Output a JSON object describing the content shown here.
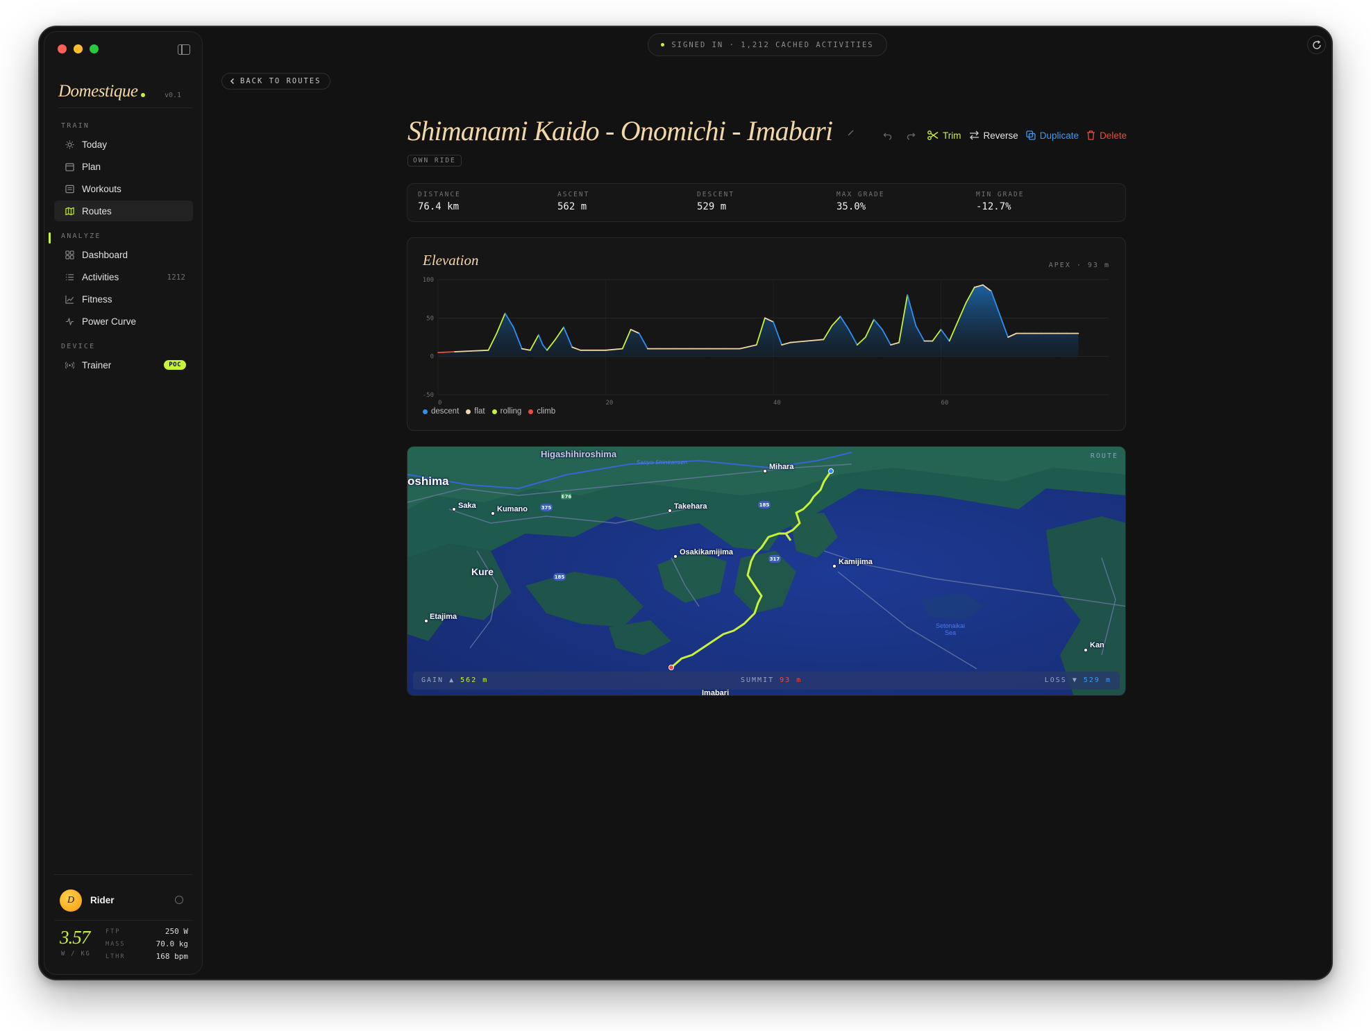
{
  "app": {
    "name": "Domestique",
    "version": "v0.1"
  },
  "status": {
    "text": "SIGNED IN · 1,212 CACHED ACTIVITIES"
  },
  "sidebar": {
    "sections": [
      {
        "label": "TRAIN"
      },
      {
        "label": "ANALYZE"
      },
      {
        "label": "DEVICE"
      }
    ],
    "items": [
      {
        "label": "Today",
        "icon": "sun-icon"
      },
      {
        "label": "Plan",
        "icon": "calendar-icon"
      },
      {
        "label": "Workouts",
        "icon": "list-icon"
      },
      {
        "label": "Routes",
        "icon": "map-icon",
        "active": true
      },
      {
        "label": "Dashboard",
        "icon": "grid-icon"
      },
      {
        "label": "Activities",
        "icon": "lines-icon",
        "count": "1212"
      },
      {
        "label": "Fitness",
        "icon": "trend-icon"
      },
      {
        "label": "Power Curve",
        "icon": "pulse-icon"
      },
      {
        "label": "Trainer",
        "icon": "broadcast-icon",
        "badge": "POC"
      }
    ],
    "user": {
      "initial": "D",
      "name": "Rider",
      "wkg": "3.57",
      "wkg_unit": "W / KG",
      "stats": [
        {
          "key": "FTP",
          "value": "250 W"
        },
        {
          "key": "MASS",
          "value": "70.0 kg"
        },
        {
          "key": "LTHR",
          "value": "168 bpm"
        }
      ]
    }
  },
  "header": {
    "back_label": "BACK TO ROUTES"
  },
  "route": {
    "title": "Shimanami Kaido - Onomichi - Imabari",
    "tag": "OWN RIDE",
    "actions": {
      "trim": "Trim",
      "reverse": "Reverse",
      "duplicate": "Duplicate",
      "delete": "Delete"
    },
    "stats": [
      {
        "key": "DISTANCE",
        "value": "76.4 km"
      },
      {
        "key": "ASCENT",
        "value": "562 m"
      },
      {
        "key": "DESCENT",
        "value": "529 m"
      },
      {
        "key": "MAX GRADE",
        "value": "35.0%"
      },
      {
        "key": "MIN GRADE",
        "value": "-12.7%"
      }
    ]
  },
  "elevation": {
    "title": "Elevation",
    "apex": "APEX · 93 m",
    "legend": [
      {
        "label": "descent",
        "color": "#2f8ff0"
      },
      {
        "label": "flat",
        "color": "#f2d7a8"
      },
      {
        "label": "rolling",
        "color": "#c8f23a"
      },
      {
        "label": "climb",
        "color": "#f04a3a"
      }
    ]
  },
  "chart_data": {
    "type": "area",
    "title": "Elevation",
    "xlabel": "",
    "ylabel": "",
    "xlim": [
      0,
      80
    ],
    "ylim": [
      -50,
      100
    ],
    "xticks": [
      "0",
      "20",
      "40",
      "60"
    ],
    "yticks": [
      "100",
      "50",
      "0",
      "-50"
    ],
    "x": [
      0,
      2,
      4,
      6,
      7,
      8,
      9,
      10,
      11,
      12,
      12.5,
      13,
      14,
      15,
      16,
      17,
      18,
      20,
      22,
      23,
      24,
      25,
      26,
      28,
      30,
      32,
      34,
      36,
      38,
      39,
      40,
      41,
      42,
      44,
      46,
      47,
      48,
      49,
      50,
      51,
      52,
      53,
      54,
      55,
      56,
      57,
      58,
      59,
      60,
      61,
      62,
      63,
      64,
      65,
      66,
      67,
      68,
      69,
      70,
      71,
      72,
      73,
      74,
      75,
      76,
      76.4
    ],
    "values": [
      5,
      6,
      7,
      8,
      30,
      56,
      38,
      10,
      8,
      28,
      15,
      8,
      22,
      38,
      12,
      8,
      8,
      8,
      10,
      35,
      30,
      10,
      10,
      10,
      10,
      10,
      10,
      10,
      15,
      50,
      45,
      15,
      18,
      20,
      22,
      40,
      52,
      35,
      15,
      25,
      48,
      35,
      15,
      18,
      80,
      40,
      20,
      20,
      35,
      20,
      45,
      70,
      90,
      93,
      85,
      55,
      25,
      30,
      30,
      30,
      30,
      30,
      30,
      30,
      30,
      30
    ]
  },
  "map": {
    "route_tag": "ROUTE",
    "places": [
      "Higashihiroshima",
      "oshima",
      "Saka",
      "Kumano",
      "Takehara",
      "Mihara",
      "Osakikamijima",
      "Kamijima",
      "Kure",
      "Etajima",
      "Setonaikai Sea",
      "Kan",
      "Imabari",
      "Sanyo Shinkansen"
    ],
    "roads": [
      "375",
      "185",
      "317",
      "E76"
    ],
    "gain_label": "GAIN ▲",
    "gain_value": "562 m",
    "summit_label": "SUMMIT",
    "summit_value": "93 m",
    "loss_label": "LOSS ▼",
    "loss_value": "529 m"
  },
  "colors": {
    "accent": "#c8f23a",
    "title": "#f2d7a8",
    "descent": "#2f8ff0",
    "delete": "#f04a3a"
  }
}
